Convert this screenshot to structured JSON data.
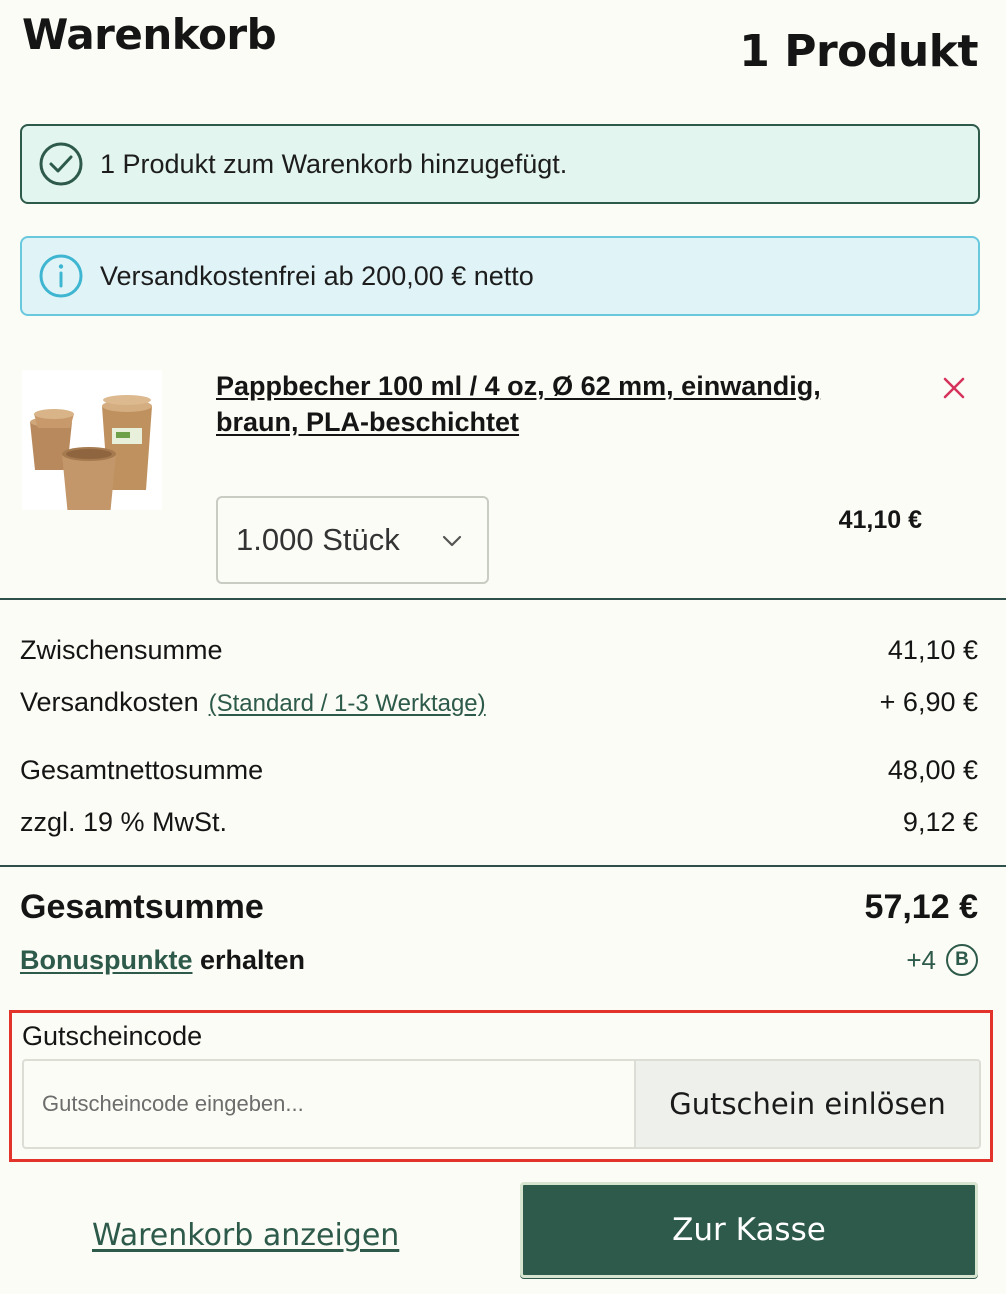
{
  "header": {
    "title": "Warenkorb",
    "count": "1 Produkt"
  },
  "alerts": {
    "success": "1 Produkt zum Warenkorb hinzugefügt.",
    "info": "Versandkostenfrei ab 200,00 € netto"
  },
  "product": {
    "name": "Pappbecher 100 ml / 4 oz, Ø 62 mm, einwandig, braun, PLA-beschichtet",
    "quantity": "1.000 Stück",
    "price": "41,10 €"
  },
  "summary": {
    "subtotal_label": "Zwischensumme",
    "subtotal_value": "41,10 €",
    "shipping_label": "Versandkosten",
    "shipping_method": "(Standard / 1-3 Werktage)",
    "shipping_value": "+ 6,90 €",
    "net_total_label": "Gesamtnettosumme",
    "net_total_value": "48,00 €",
    "vat_label": "zzgl. 19 % MwSt.",
    "vat_value": "9,12 €",
    "total_label": "Gesamtsumme",
    "total_value": "57,12 €",
    "bonus_link": "Bonuspunkte",
    "bonus_text": " erhalten",
    "bonus_value": "+4",
    "bonus_badge": "B"
  },
  "voucher": {
    "label": "Gutscheincode",
    "placeholder": "Gutscheincode eingeben...",
    "button": "Gutschein einlösen"
  },
  "actions": {
    "show_cart": "Warenkorb anzeigen",
    "checkout": "Zur Kasse"
  },
  "colors": {
    "primary": "#2d5a4a",
    "background": "#fbfcf5",
    "success_bg": "#e2f5ee",
    "info_bg": "#e0f4f8",
    "info_border": "#69c8dd",
    "remove": "#d6335c",
    "highlight": "#e2342b"
  },
  "icons": {
    "success": "check-circle-icon",
    "info": "info-circle-icon",
    "remove": "close-icon",
    "dropdown": "chevron-down-icon"
  }
}
